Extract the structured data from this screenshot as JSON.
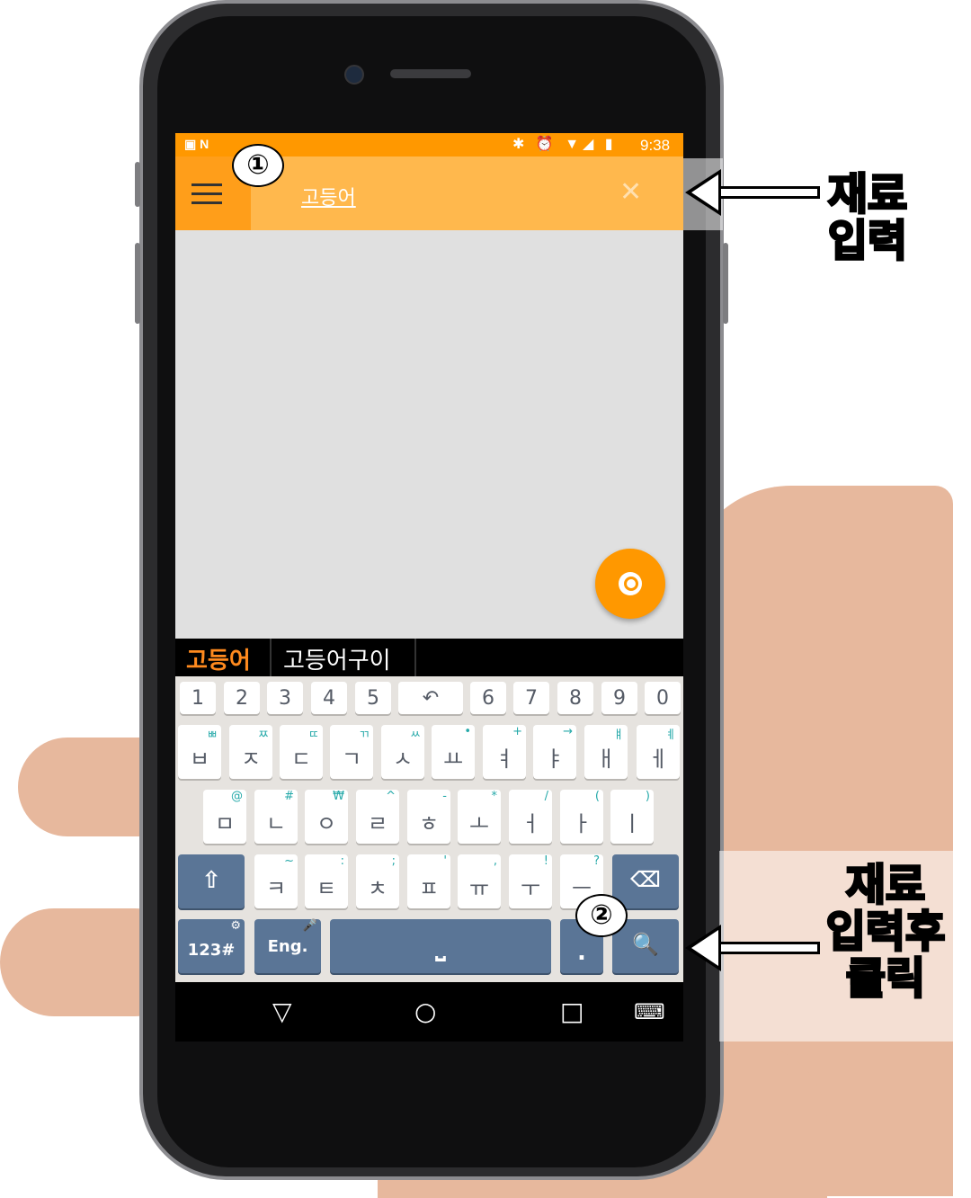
{
  "status_bar": {
    "left_icons": "▣ N",
    "right_icons": "✱ ⏰ ▼◢ ▮",
    "time": "9:38"
  },
  "app_bar": {
    "search_value": "고등어",
    "clear_icon": "✕"
  },
  "suggestions": [
    "고등어",
    "고등어구이"
  ],
  "keyboard": {
    "number_row": [
      "1",
      "2",
      "3",
      "4",
      "5",
      "↶",
      "6",
      "7",
      "8",
      "9",
      "0"
    ],
    "row1": [
      {
        "k": "ㅂ",
        "s": "ㅃ"
      },
      {
        "k": "ㅈ",
        "s": "ㅉ"
      },
      {
        "k": "ㄷ",
        "s": "ㄸ"
      },
      {
        "k": "ㄱ",
        "s": "ㄲ"
      },
      {
        "k": "ㅅ",
        "s": "ㅆ"
      },
      {
        "k": "ㅛ",
        "s": "•"
      },
      {
        "k": "ㅕ",
        "s": "+"
      },
      {
        "k": "ㅑ",
        "s": "→"
      },
      {
        "k": "ㅐ",
        "s": "ㅒ"
      },
      {
        "k": "ㅔ",
        "s": "ㅖ"
      }
    ],
    "row2": [
      {
        "k": "ㅁ",
        "s": "@"
      },
      {
        "k": "ㄴ",
        "s": "#"
      },
      {
        "k": "ㅇ",
        "s": "₩"
      },
      {
        "k": "ㄹ",
        "s": "^"
      },
      {
        "k": "ㅎ",
        "s": "-"
      },
      {
        "k": "ㅗ",
        "s": "*"
      },
      {
        "k": "ㅓ",
        "s": "/"
      },
      {
        "k": "ㅏ",
        "s": "("
      },
      {
        "k": "ㅣ",
        "s": ")"
      }
    ],
    "row3": [
      {
        "k": "ㅋ",
        "s": "~"
      },
      {
        "k": "ㅌ",
        "s": ":"
      },
      {
        "k": "ㅊ",
        "s": ";"
      },
      {
        "k": "ㅍ",
        "s": "'"
      },
      {
        "k": "ㅠ",
        "s": ","
      },
      {
        "k": "ㅜ",
        "s": "!"
      },
      {
        "k": "ㅡ",
        "s": "?"
      }
    ],
    "shift": "⇧",
    "backspace": "⌫",
    "num_key": "123#",
    "num_key_sub": "⚙",
    "lang_key": "Eng.",
    "lang_key_sub": "🎤",
    "space": "⎵",
    "period": ".",
    "search": "🔍"
  },
  "nav_bar": {
    "back": "▽",
    "home": "○",
    "recents": "□",
    "keyboard": "⌨"
  },
  "annotations": {
    "callout_1": "①",
    "callout_2": "②",
    "label_1": "재료\n입력",
    "label_2": "재료\n입력후\n클릭"
  },
  "colors": {
    "accent": "#ff9800",
    "appbar": "#ff9e1a",
    "key_dark": "#5a7596",
    "suggest_active": "#ff8a1e"
  }
}
